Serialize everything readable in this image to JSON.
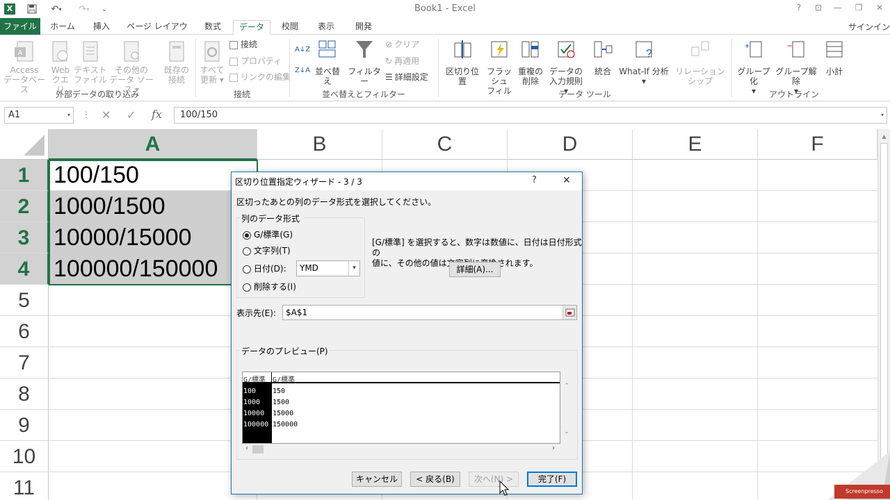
{
  "titlebar": {
    "title": "Book1 - Excel",
    "help": "?",
    "ribbon_display": "⊡",
    "minimize": "—",
    "restore": "❐",
    "close": "✕",
    "app_icon": "X",
    "save_icon": "💾",
    "undo": "↶",
    "redo": "↷",
    "customize": "⌄"
  },
  "tabs": {
    "file": "ファイル",
    "items": [
      "ホーム",
      "挿入",
      "ページ レイアウト",
      "数式",
      "データ",
      "校閲",
      "表示",
      "開発"
    ],
    "signin": "サインイン"
  },
  "ribbon": {
    "external": {
      "access": [
        "Access",
        "データベース"
      ],
      "web": [
        "Web",
        "クエリ"
      ],
      "text": [
        "テキスト",
        "ファイル"
      ],
      "other": [
        "その他の",
        "データ ソース ▾"
      ],
      "existing": [
        "既存の",
        "接続"
      ],
      "label": "外部データの取り込み"
    },
    "connections": {
      "refresh": [
        "すべて",
        "更新 ▾"
      ],
      "connect": "接続",
      "properties": "プロパティ",
      "edit_links": "リンクの編集",
      "label": "接続"
    },
    "sort": {
      "az": "A↓Z",
      "za": "Z↓A",
      "sort": "並べ替え",
      "filter": "フィルター",
      "clear": "クリア",
      "reapply": "再適用",
      "advanced": "詳細設定",
      "label": "並べ替えとフィルター"
    },
    "tools": {
      "text_to_columns": "区切り位置",
      "flash_fill": [
        "フラッシュ",
        "フィル"
      ],
      "remove_dup": [
        "重複の",
        "削除"
      ],
      "validation": [
        "データの",
        "入力規則 ▾"
      ],
      "consolidate": "統合",
      "whatif": [
        "What-If 分析",
        "▾"
      ],
      "relationships": "リレーションシップ",
      "label": "データ ツール"
    },
    "outline": {
      "group": [
        "グループ化",
        "▾"
      ],
      "ungroup": [
        "グループ解除",
        "▾"
      ],
      "subtotal": "小計",
      "label": "アウトライン"
    }
  },
  "formulabar": {
    "namebox": "A1",
    "cancel": "✕",
    "enter": "✓",
    "fx": "fx",
    "formula": "100/150"
  },
  "grid": {
    "columns": [
      "A",
      "B",
      "C",
      "D",
      "E",
      "F"
    ],
    "rows": [
      "1",
      "2",
      "3",
      "4",
      "5",
      "6",
      "7",
      "8",
      "9",
      "10",
      "11"
    ],
    "cells": [
      "100/150",
      "1000/1500",
      "10000/15000",
      "100000/150000"
    ]
  },
  "dialog": {
    "title": "区切り位置指定ウィザード - 3 / 3",
    "help": "?",
    "close": "✕",
    "instruction": "区切ったあとの列のデータ形式を選択してください。",
    "format_group": "列のデータ形式",
    "radio_general": "G/標準(G)",
    "radio_text": "文字列(T)",
    "radio_date": "日付(D):",
    "date_value": "YMD",
    "radio_skip": "削除する(I)",
    "desc_line1": "[G/標準] を選択すると、数字は数値に、日付は日付形式の",
    "desc_line2": "値に、その他の値は文字列に変換されます。",
    "advanced": "詳細(A)...",
    "dest_label": "表示先(E):",
    "dest_value": "$A$1",
    "preview_label": "データのプレビュー(P)",
    "preview_headers": [
      "G/標準",
      "G/標準"
    ],
    "preview_rows": [
      [
        "100",
        "150"
      ],
      [
        "1000",
        "1500"
      ],
      [
        "10000",
        "15000"
      ],
      [
        "100000",
        "150000"
      ]
    ],
    "cancel": "キャンセル",
    "back": "< 戻る(B)",
    "next": "次へ(N) >",
    "finish": "完了(F)"
  },
  "watermark": "Screenpresso"
}
